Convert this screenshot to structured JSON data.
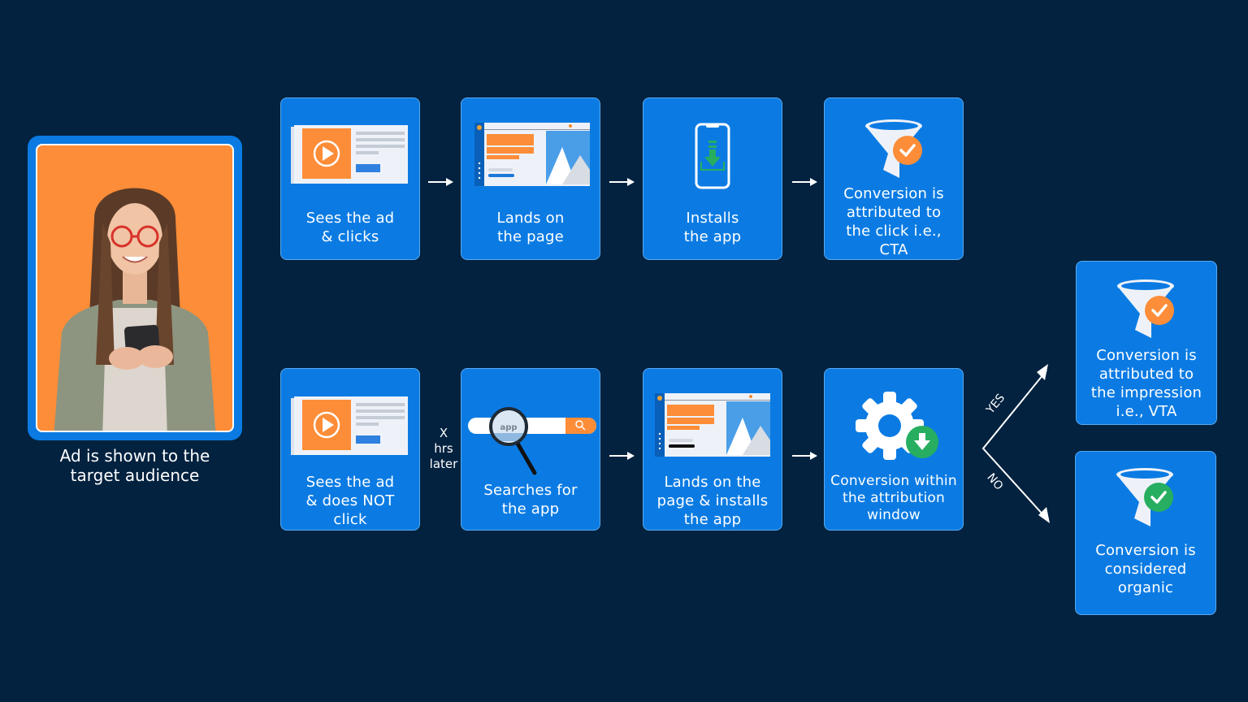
{
  "audience": {
    "caption_line1": "Ad is shown to the",
    "caption_line2": "target audience",
    "image": "woman-smiling-at-phone"
  },
  "top_row": [
    {
      "line1": "Sees the ad",
      "line2": "& clicks",
      "icon": "video-ad-icon"
    },
    {
      "line1": "Lands on",
      "line2": "the page",
      "icon": "landing-page-icon"
    },
    {
      "line1": "Installs",
      "line2": "the app",
      "icon": "phone-download-icon"
    },
    {
      "line1": "Conversion is",
      "line2": "attributed to",
      "line3": "the click i.e.,",
      "line4": "CTA",
      "icon": "funnel-check-icon"
    }
  ],
  "bottom_row": [
    {
      "line1": "Sees the ad",
      "line2": "& does NOT",
      "line3": "click",
      "icon": "video-ad-icon"
    },
    {
      "line1": "Searches for",
      "line2": "the app",
      "icon": "search-bar-icon",
      "search_text": "app"
    },
    {
      "line1": "Lands on the",
      "line2": "page & installs",
      "line3": "the app",
      "icon": "landing-page-icon"
    },
    {
      "line1": "Conversion within",
      "line2": "the attribution",
      "line3": "window",
      "icon": "gear-download-icon"
    }
  ],
  "delay_label": {
    "line1": "X",
    "line2": "hrs",
    "line3": "later"
  },
  "branch": {
    "yes": "YES",
    "no": "NO"
  },
  "outcomes": [
    {
      "line1": "Conversion is",
      "line2": "attributed to",
      "line3": "the impression",
      "line4": "i.e., VTA",
      "icon": "funnel-check-icon"
    },
    {
      "line1": "Conversion is",
      "line2": "considered",
      "line3": "organic",
      "icon": "funnel-check-icon"
    }
  ],
  "colors": {
    "background": "#02223f",
    "box": "#0b7be3",
    "orange": "#fd8d38",
    "green": "#27ae60"
  }
}
